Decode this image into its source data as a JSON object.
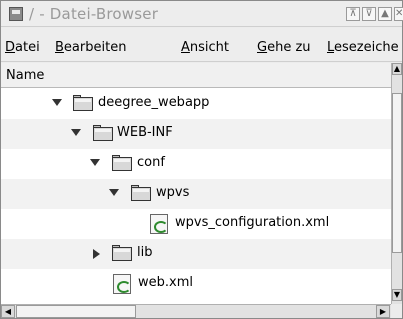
{
  "window": {
    "title": "/ - Datei-Browser"
  },
  "menubar": {
    "items": [
      {
        "label": "Datei",
        "mnemonic": "D",
        "rest": "atei"
      },
      {
        "label": "Bearbeiten",
        "mnemonic": "B",
        "rest": "earbeiten"
      },
      {
        "label": "Ansicht",
        "mnemonic": "A",
        "rest": "nsicht"
      },
      {
        "label": "Gehe zu",
        "mnemonic": "G",
        "rest": "ehe zu"
      },
      {
        "label": "Lesezeichen",
        "mnemonic": "L",
        "rest": "esezeiche"
      }
    ]
  },
  "tree": {
    "column_header": "Name",
    "rows": [
      {
        "name": "deegree_webapp",
        "type": "folder",
        "expanded": true,
        "depth": 0
      },
      {
        "name": "WEB-INF",
        "type": "folder",
        "expanded": true,
        "depth": 1
      },
      {
        "name": "conf",
        "type": "folder",
        "expanded": true,
        "depth": 2
      },
      {
        "name": "wpvs",
        "type": "folder",
        "expanded": true,
        "depth": 3
      },
      {
        "name": "wpvs_configuration.xml",
        "type": "xml-file",
        "depth": 4
      },
      {
        "name": "lib",
        "type": "folder",
        "expanded": false,
        "depth": 2
      },
      {
        "name": "web.xml",
        "type": "xml-file",
        "depth": 2
      }
    ]
  },
  "icons": {
    "app": "file-browser-icon",
    "folder": "folder-icon",
    "xml_file": "xml-file-icon"
  },
  "colors": {
    "row_alt": "#f2f2f2",
    "title_text": "#9a9a9a"
  }
}
